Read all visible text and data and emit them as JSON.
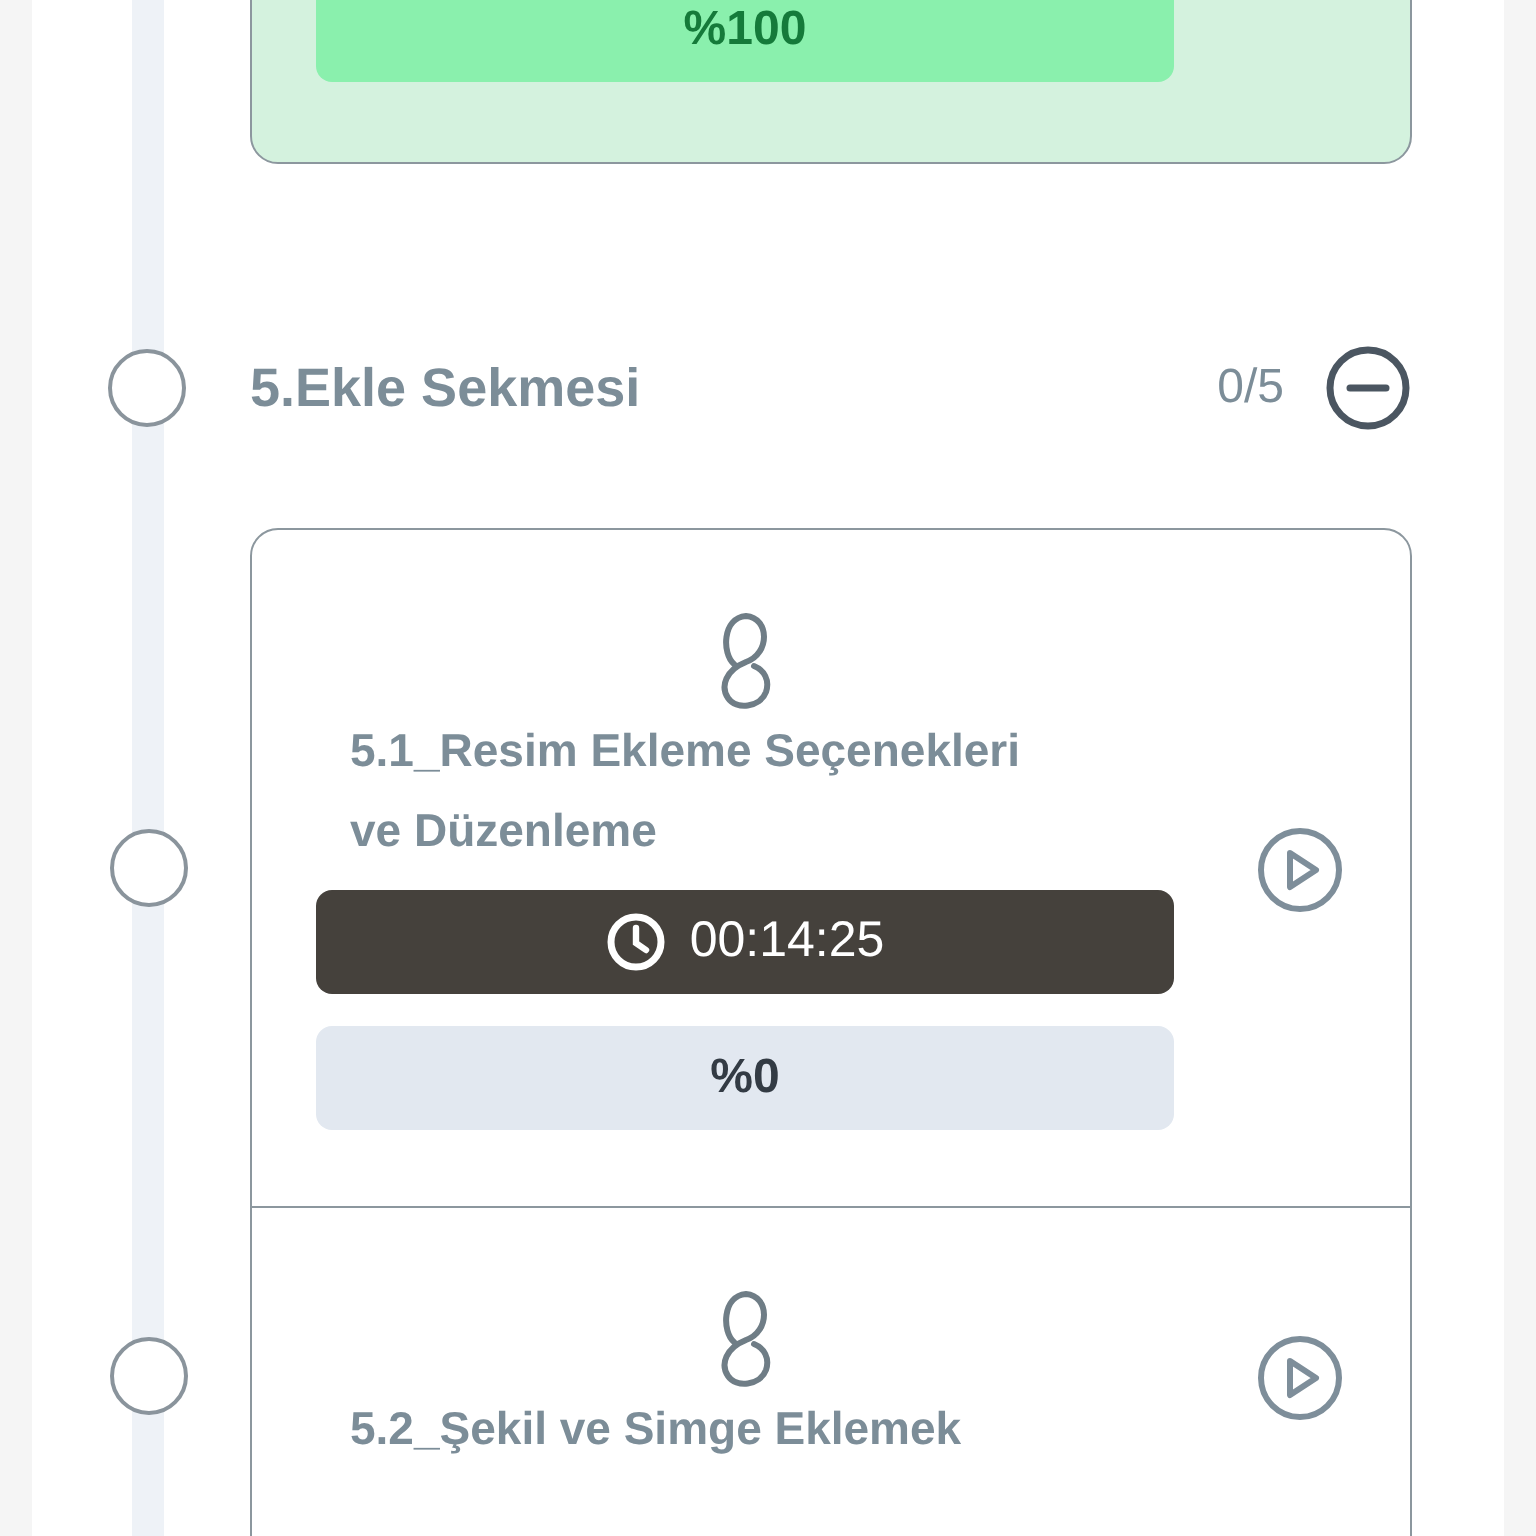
{
  "previous_lesson": {
    "progress": "%100",
    "completed": true
  },
  "section": {
    "title": "5.Ekle Sekmesi",
    "count": "0/5",
    "expanded": true
  },
  "lessons": [
    {
      "title": "5.1_Resim Ekleme Seçenekleri ve Düzenleme",
      "duration": "00:14:25",
      "progress": "%0",
      "completed": false
    },
    {
      "title": "5.2_Şekil ve Simge Eklemek",
      "completed": false
    }
  ]
}
